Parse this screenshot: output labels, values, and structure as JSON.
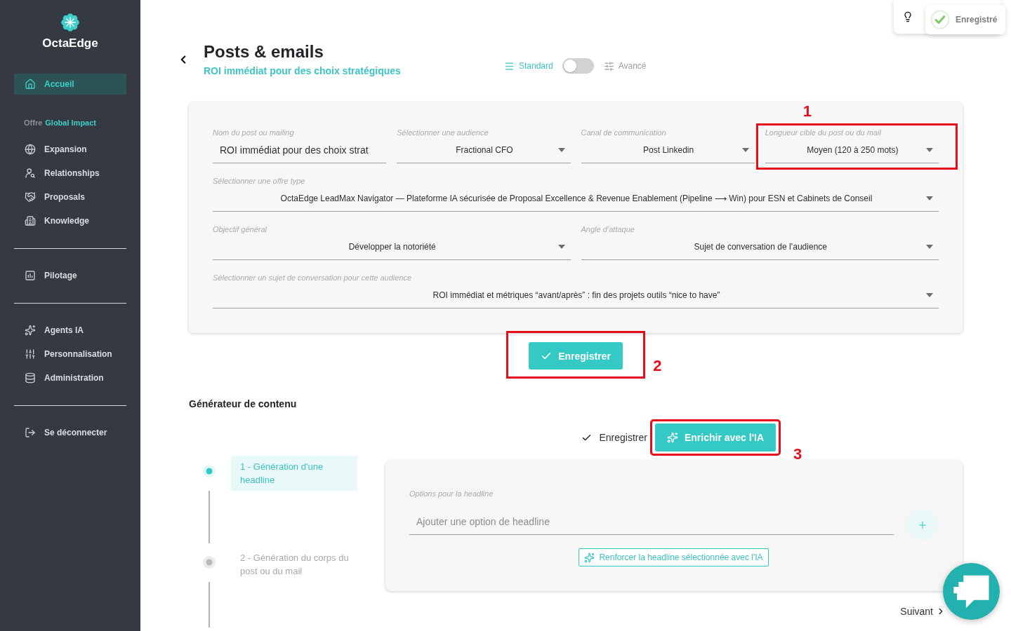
{
  "sidebar": {
    "brand": "OctaEdge",
    "home": {
      "label": "Accueil",
      "selected": true
    },
    "groups": [
      {
        "heading": {
          "prefix": "Offre",
          "name": "Global Impact"
        },
        "items": [
          {
            "label": "Expansion",
            "selected": false
          },
          {
            "label": "Relationships",
            "selected": false
          },
          {
            "label": "Proposals",
            "selected": false
          },
          {
            "label": "Knowledge",
            "selected": false
          }
        ]
      },
      {
        "items": [
          {
            "label": "Pilotage",
            "selected": false
          }
        ]
      },
      {
        "items": [
          {
            "label": "Agents IA",
            "selected": false
          },
          {
            "label": "Personnalisation",
            "selected": false
          },
          {
            "label": "Administration",
            "selected": false
          }
        ]
      },
      {
        "items": [
          {
            "label": "Se déconnecter",
            "selected": false
          }
        ]
      }
    ]
  },
  "toast": {
    "text": "Enregistré"
  },
  "header": {
    "title": "Posts & emails",
    "subtitle": "ROI immédiat pour des choix stratégiques",
    "modes": [
      {
        "label": "Standard",
        "selected": true
      },
      {
        "label": "Avancé",
        "selected": false
      }
    ]
  },
  "form": {
    "field_groups": [
      {
        "fields": [
          {
            "kind": "text",
            "label": "Nom du post ou mailing",
            "value": "ROI immédiat pour des choix strat"
          },
          {
            "kind": "select",
            "label": "Sélectionner une audience",
            "value": "Fractional CFO"
          },
          {
            "kind": "select",
            "label": "Canal de communication",
            "value": "Post Linkedin"
          },
          {
            "kind": "select",
            "label": "Longueur cible du post ou du mail",
            "value": "Moyen (120 à 250 mots)",
            "callout": "1"
          }
        ]
      },
      {
        "fields": [
          {
            "kind": "select",
            "label": "Sélectionner une offre type",
            "value": "OctaEdge LeadMax Navigator — Plateforme IA sécurisée de Proposal Excellence & Revenue Enablement (Pipeline ⟶ Win) pour ESN et Cabinets de Conseil"
          }
        ]
      },
      {
        "fields": [
          {
            "kind": "select",
            "label": "Objectif général",
            "value": "Développer la notoriété"
          },
          {
            "kind": "select",
            "label": "Angle d’attaque",
            "value": "Sujet de conversation de l’audience"
          }
        ]
      },
      {
        "fields": [
          {
            "kind": "select",
            "label": "Sélectionner un sujet de conversation pour cette audience",
            "value": "ROI immédiat et métriques “avant/après” : fin des projets outils “nice to have”"
          }
        ]
      }
    ],
    "save_button": {
      "label": "Enregistrer",
      "callout": "2"
    }
  },
  "generator": {
    "title": "Générateur de contenu",
    "save_link": "Enregistrer",
    "enrich_button": {
      "label": "Enrichir avec l'IA",
      "callout": "3"
    },
    "steps": [
      {
        "label": "1 - Génération d'une headline",
        "selected": true
      },
      {
        "label": "2 - Génération du corps du post ou du mail",
        "selected": false
      }
    ],
    "panel": {
      "label": "Options pour la headline",
      "placeholder": "Ajouter une option de headline",
      "reinforce_button": "Renforcer la headline sélectionnée avec l'IA"
    },
    "next_button": "Suivant"
  }
}
